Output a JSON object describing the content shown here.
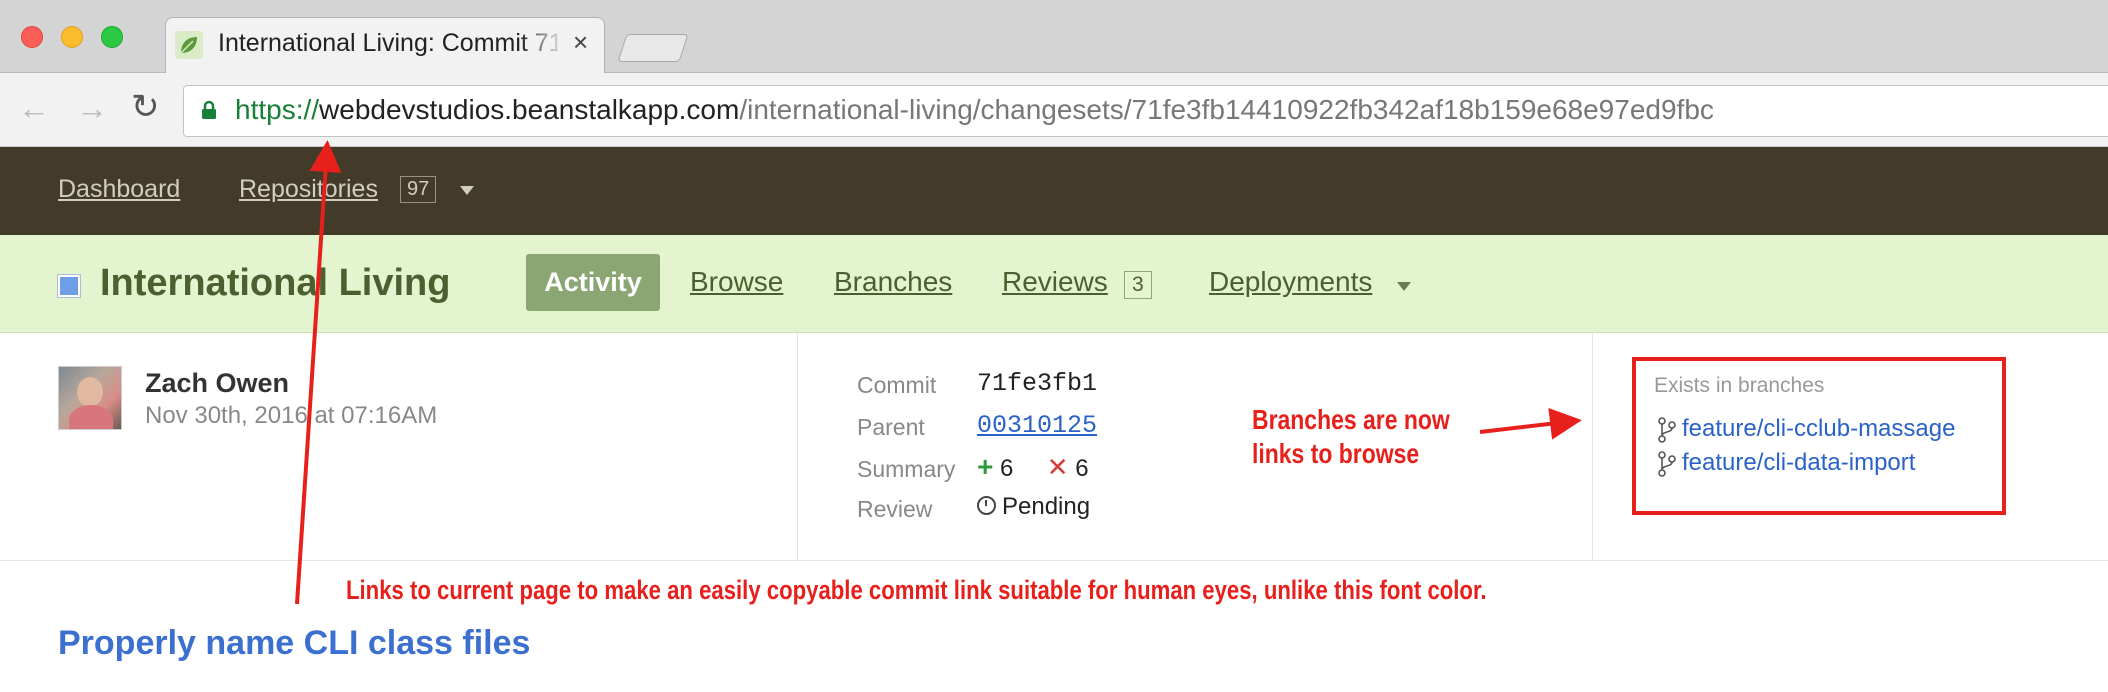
{
  "browser": {
    "tab_title": "International Living: Commit 71",
    "tab_close": "×",
    "url_scheme": "https://",
    "url_host": "webdevstudios.beanstalkapp.com",
    "url_path": "/international-living/changesets/71fe3fb14410922fb342af18b159e68e97ed9fbc",
    "icons": [
      "back-arrow-icon",
      "forward-arrow-icon",
      "reload-icon",
      "lock-icon",
      "leaf-favicon-icon"
    ]
  },
  "appnav": {
    "dashboard": "Dashboard",
    "repositories": "Repositories",
    "repositories_count": "97"
  },
  "repo": {
    "name": "International Living",
    "square_color": "#6e9ee8",
    "tabs": {
      "activity": "Activity",
      "browse": "Browse",
      "branches": "Branches",
      "reviews": "Reviews",
      "reviews_count": "3",
      "deployments": "Deployments"
    }
  },
  "commit": {
    "author": "Zach Owen",
    "date": "Nov 30th, 2016 at 07:16AM",
    "labels": {
      "commit": "Commit",
      "parent": "Parent",
      "summary": "Summary",
      "review": "Review"
    },
    "hash": "71fe3fb1",
    "parent": "00310125",
    "additions": "6",
    "deletions": "6",
    "plus_symbol": "+",
    "cross_symbol": "✕",
    "review_status": "Pending",
    "branches_title": "Exists in branches",
    "branches": [
      "feature/cli-cclub-massage",
      "feature/cli-data-import"
    ],
    "message": "Properly name CLI class files"
  },
  "annotations": {
    "color": "#e8201c",
    "branches_note_line1": "Branches are now",
    "branches_note_line2": "links to browse",
    "hash_note": "Links to current page to make an easily copyable commit link suitable for human eyes, unlike this font color."
  }
}
